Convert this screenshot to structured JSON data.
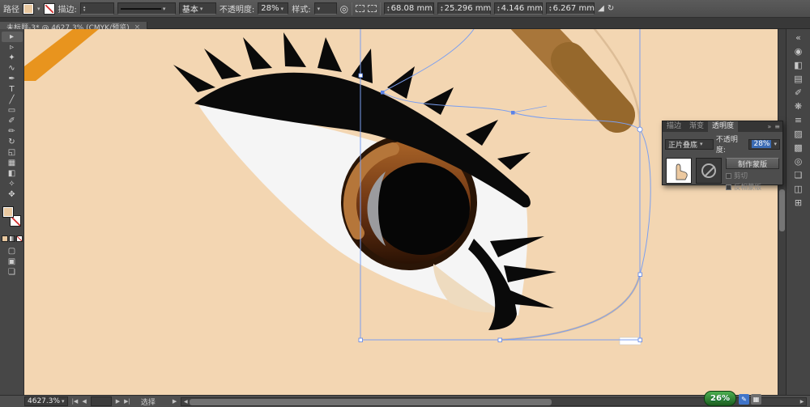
{
  "colors": {
    "canvas_bg": "#f3d6b2",
    "selection_accent": "#7b9ff0",
    "eyebrow_brown": "#a8763a",
    "iris_brown": "#8a4a1a",
    "lash_black": "#0a0a0a",
    "badge_green": "#2e7d32"
  },
  "control_bar": {
    "object_type": "路径",
    "stroke_label": "描边:",
    "brush_name": "基本",
    "opacity_label": "不透明度:",
    "opacity_value": "28%",
    "style_label": "样式:",
    "x_value": "68.08 mm",
    "y_value": "25.296 mm",
    "w_value": "4.146 mm",
    "h_value": "6.267 mm"
  },
  "document_tab": {
    "title": "未标题-3* @ 4627.3% (CMYK/预览)"
  },
  "icons": {
    "caret": "▾",
    "caret_up": "▴",
    "left": "◀",
    "right": "▶",
    "first": "|◀",
    "last": "▶|",
    "dbl_right": "»",
    "menu": "≡",
    "close": "×",
    "recolor": "◎",
    "shear": "◢",
    "rotate": "↻",
    "diamond": "◇"
  },
  "toolbar": {
    "tools": [
      {
        "name": "selection-tool",
        "glyph": "▸"
      },
      {
        "name": "direct-selection-tool",
        "glyph": "▹"
      },
      {
        "name": "magic-wand-tool",
        "glyph": "✦"
      },
      {
        "name": "lasso-tool",
        "glyph": "∿"
      },
      {
        "name": "pen-tool",
        "glyph": "✒"
      },
      {
        "name": "type-tool",
        "glyph": "T"
      },
      {
        "name": "line-tool",
        "glyph": "╱"
      },
      {
        "name": "rectangle-tool",
        "glyph": "▭"
      },
      {
        "name": "paintbrush-tool",
        "glyph": "✐"
      },
      {
        "name": "pencil-tool",
        "glyph": "✏"
      },
      {
        "name": "rotate-tool",
        "glyph": "↻"
      },
      {
        "name": "scale-tool",
        "glyph": "◱"
      },
      {
        "name": "mesh-tool",
        "glyph": "▦"
      },
      {
        "name": "gradient-tool",
        "glyph": "◧"
      },
      {
        "name": "eyedropper-tool",
        "glyph": "✧"
      },
      {
        "name": "hand-tool",
        "glyph": "✥"
      }
    ],
    "extras": [
      {
        "name": "draw-normal-mode",
        "glyph": "▢"
      },
      {
        "name": "draw-behind-mode",
        "glyph": "▣"
      },
      {
        "name": "screen-mode",
        "glyph": "❏"
      }
    ]
  },
  "dock": {
    "icons": [
      {
        "name": "expand-dock",
        "glyph": "«"
      },
      {
        "name": "color-panel",
        "glyph": "◉"
      },
      {
        "name": "color-guide-panel",
        "glyph": "◧"
      },
      {
        "name": "swatches-panel",
        "glyph": "▤"
      },
      {
        "name": "brushes-panel",
        "glyph": "✐"
      },
      {
        "name": "symbols-panel",
        "glyph": "❋"
      },
      {
        "name": "stroke-panel",
        "glyph": "≡"
      },
      {
        "name": "gradient-panel",
        "glyph": "▨"
      },
      {
        "name": "transparency-panel",
        "glyph": "▩"
      },
      {
        "name": "appearance-panel",
        "glyph": "◎"
      },
      {
        "name": "graphic-styles-panel",
        "glyph": "❏"
      },
      {
        "name": "layers-panel",
        "glyph": "◫"
      },
      {
        "name": "artboards-panel",
        "glyph": "⊞"
      }
    ]
  },
  "panel": {
    "tab_stroke": "描边",
    "tab_gradient": "渐变",
    "tab_transparency": "透明度",
    "blend_mode": "正片叠底",
    "opacity_label": "不透明度:",
    "opacity_value": "28%",
    "make_mask_label": "制作蒙版",
    "clip_label": "剪切",
    "invert_label": "反相蒙版"
  },
  "status_bar": {
    "zoom_value": "4627.3%",
    "tool_hint": "选择",
    "badge_value": "26%"
  }
}
